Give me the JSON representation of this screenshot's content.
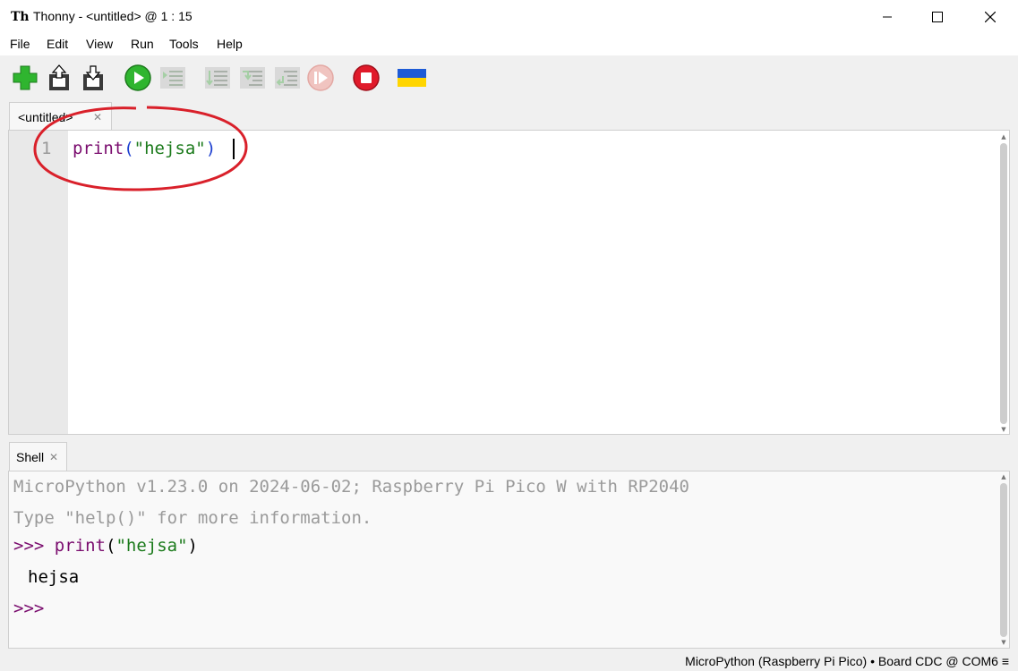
{
  "window": {
    "title": "Thonny  -  <untitled>  @  1 : 15",
    "minimize": "—",
    "maximize": "☐",
    "close": "✕"
  },
  "menu": [
    "File",
    "Edit",
    "View",
    "Run",
    "Tools",
    "Help"
  ],
  "toolbar": {
    "icons": [
      "new-file-icon",
      "open-file-icon",
      "save-file-icon",
      "run-icon",
      "debug-icon",
      "step-over-icon",
      "step-into-icon",
      "step-out-icon",
      "resume-icon",
      "stop-icon",
      "ukraine-flag-icon"
    ]
  },
  "editor": {
    "tab_label": "<untitled>",
    "tab_close": "✕",
    "line_number": "1",
    "code": {
      "func": "print",
      "open": "(",
      "string": "\"hejsa\"",
      "close": ")"
    }
  },
  "shell": {
    "tab_label": "Shell",
    "tab_close": "✕",
    "banner": "MicroPython v1.23.0 on 2024-06-02; Raspberry Pi Pico W with RP2040",
    "help_hint": "Type \"help()\" for more information.",
    "prompt": ">>>",
    "command": {
      "func": "print",
      "open": "(",
      "string": "\"hejsa\"",
      "close": ")"
    },
    "output": "hejsa",
    "next_prompt": ">>>"
  },
  "status": {
    "interpreter": "MicroPython (Raspberry Pi Pico)",
    "separator": "•",
    "port": "Board CDC @ COM6",
    "menu_icon": "≡"
  },
  "colors": {
    "annotation_circle": "#d9202a",
    "keyword": "#7a0c6e",
    "string": "#1b7a1b",
    "paren": "#1d3fd0"
  }
}
